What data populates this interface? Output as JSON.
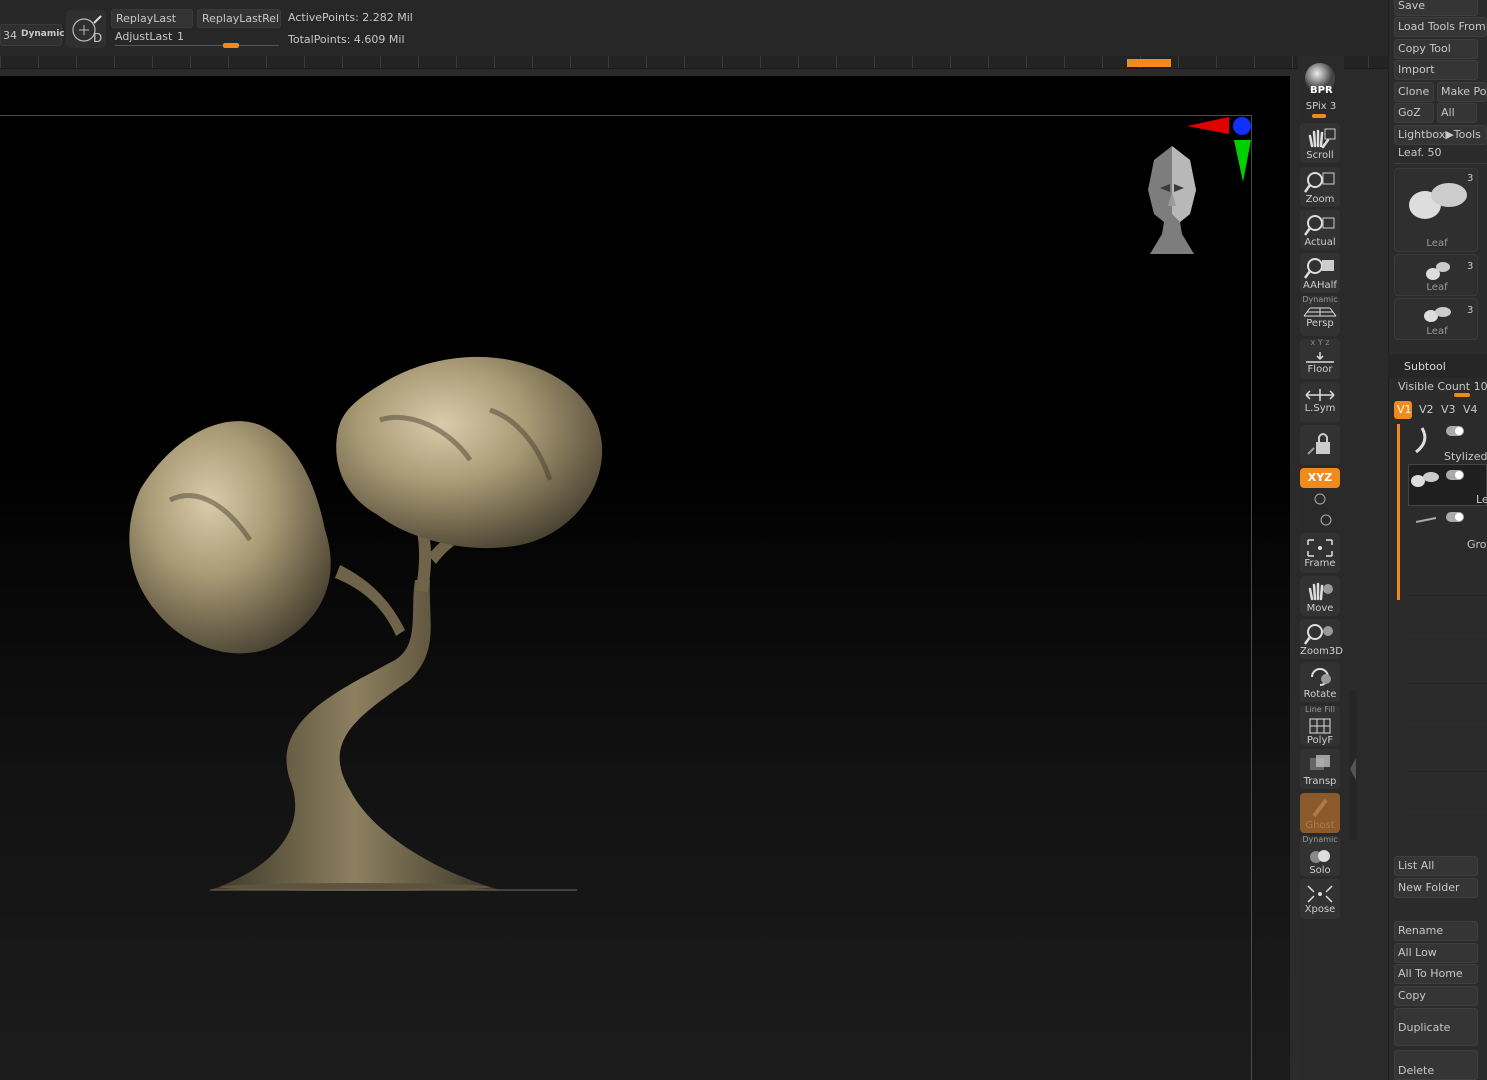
{
  "topbar": {
    "brush_size_value": "34",
    "dynamic_label": "Dynamic",
    "replay_last": "ReplayLast",
    "replay_last_rel": "ReplayLastRel",
    "adjust_last": "AdjustLast",
    "adjust_last_value": "1",
    "adjust_last_level": 0.47,
    "active_points": "ActivePoints: 2.282 Mil",
    "total_points": "TotalPoints: 4.609 Mil",
    "picker_letter": "D"
  },
  "vtool": {
    "bpr": "BPR",
    "spix": "SPix 3",
    "scroll": "Scroll",
    "zoom": "Zoom",
    "actual": "Actual",
    "aahalf": "AAHalf",
    "persp_top": "Dynamic",
    "persp": "Persp",
    "floor_axes": "x Y z",
    "floor": "Floor",
    "lsym": "L.Sym",
    "xyz": "XYZ",
    "frame": "Frame",
    "move": "Move",
    "zoom3d": "Zoom3D",
    "rotate": "Rotate",
    "polyf_top": "Line Fill",
    "polyf": "PolyF",
    "transp": "Transp",
    "ghost": "Ghost",
    "solo_top": "Dynamic",
    "solo": "Solo",
    "xpose": "Xpose"
  },
  "panel": {
    "save": "Save",
    "load_tools": "Load Tools From",
    "copy_tool": "Copy Tool",
    "import": "Import",
    "clone": "Clone",
    "make_po": "Make Po",
    "goz": "GoZ",
    "all": "All",
    "lightbox_tools": "Lightbox▶Tools",
    "leaf_slider": "Leaf. 50",
    "thumbs": [
      {
        "label": "Leaf",
        "count": "3"
      },
      {
        "label": "Leaf",
        "count": "3"
      },
      {
        "label": "Leaf",
        "count": "3"
      }
    ],
    "subtool_title": "Subtool",
    "visible_count": "Visible Count 10",
    "visible_count_level": 0.4,
    "tabs": [
      "V1",
      "V2",
      "V3",
      "V4"
    ],
    "subtools": [
      "Stylized",
      "Le",
      "Gro"
    ],
    "list_all": "List All",
    "new_folder": "New Folder",
    "rename": "Rename",
    "all_low": "All Low",
    "all_to_home": "All To Home",
    "copy": "Copy",
    "duplicate": "Duplicate",
    "delete": "Delete"
  },
  "colors": {
    "accent_orange": "#f08a1c",
    "axis_red": "#e00000",
    "axis_green": "#00d000",
    "axis_blue": "#1030ff"
  }
}
